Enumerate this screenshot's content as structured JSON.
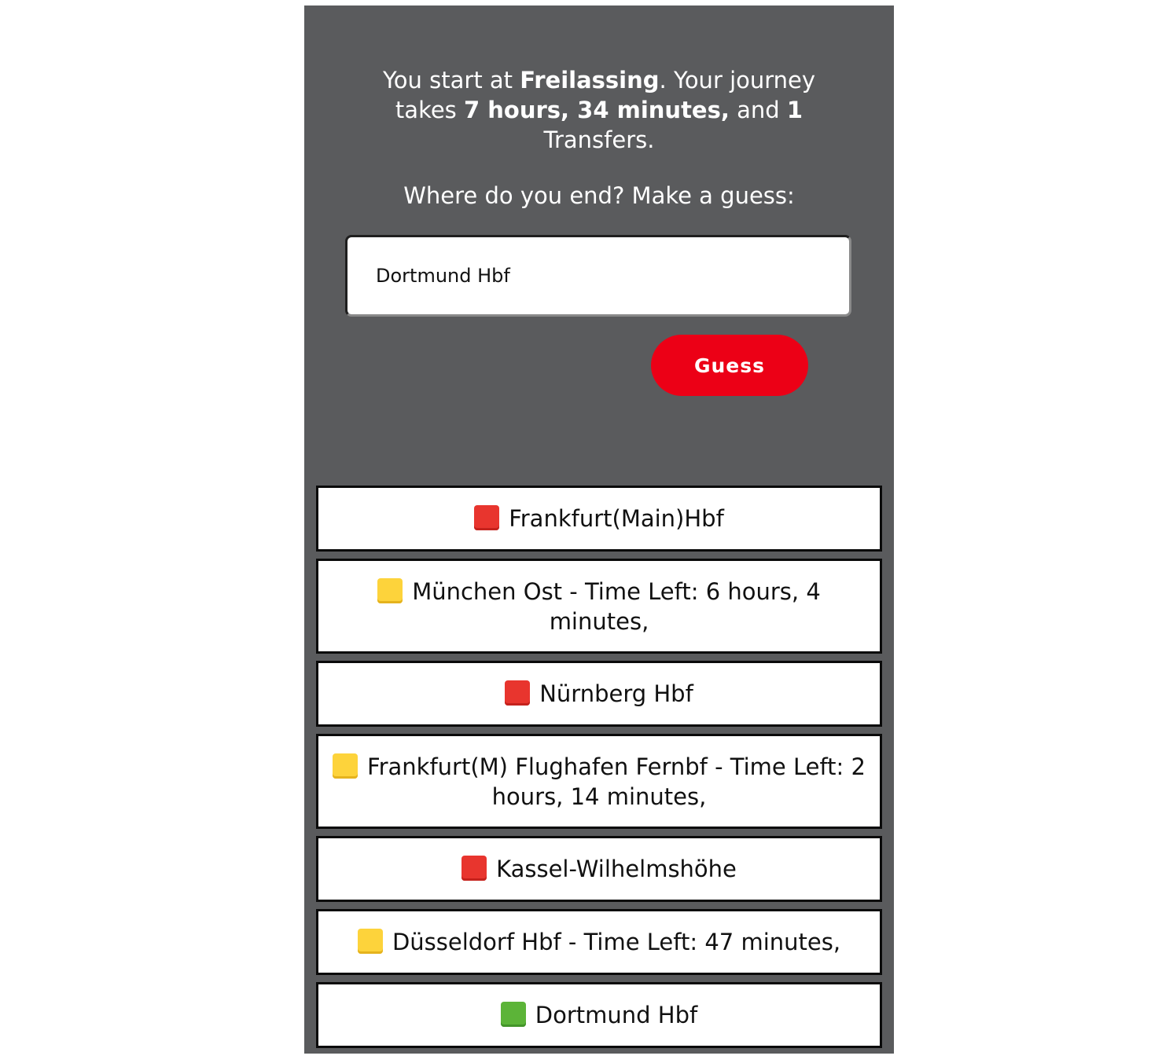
{
  "intro": {
    "prefix": "You start at ",
    "start_station": "Freilassing",
    "mid": ". Your journey takes ",
    "duration": "7 hours, 34 minutes,",
    "and": " and ",
    "transfers_count": "1",
    "suffix": " Transfers."
  },
  "question": "Where do you end? Make a guess:",
  "input": {
    "value": "Dortmund Hbf"
  },
  "guess_button_label": "Guess",
  "colors": {
    "panel": "#5a5b5d",
    "button": "#ec0016",
    "red": "#e8352e",
    "yellow": "#fdd33b",
    "green": "#5cb438"
  },
  "guesses": [
    {
      "status": "red",
      "icon": "red-square-icon",
      "text": "Frankfurt(Main)Hbf"
    },
    {
      "status": "yellow",
      "icon": "yellow-square-icon",
      "text": "München Ost - Time Left: 6 hours, 4 minutes,"
    },
    {
      "status": "red",
      "icon": "red-square-icon",
      "text": "Nürnberg Hbf"
    },
    {
      "status": "yellow",
      "icon": "yellow-square-icon",
      "text": "Frankfurt(M) Flughafen Fernbf - Time Left: 2 hours, 14 minutes,"
    },
    {
      "status": "red",
      "icon": "red-square-icon",
      "text": "Kassel-Wilhelmshöhe"
    },
    {
      "status": "yellow",
      "icon": "yellow-square-icon",
      "text": "Düsseldorf Hbf - Time Left: 47 minutes,"
    },
    {
      "status": "green",
      "icon": "green-square-icon",
      "text": "Dortmund Hbf"
    }
  ]
}
